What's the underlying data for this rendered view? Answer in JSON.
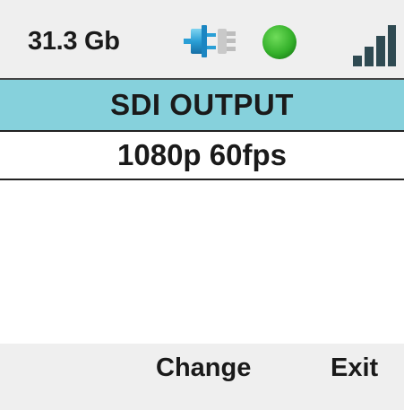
{
  "status": {
    "storage": "31.3 Gb",
    "power_icon": "power-plug-icon",
    "status_dot_icon": "status-dot-icon",
    "status_color": "#3cb043",
    "signal_icon": "signal-strength-icon",
    "signal_color": "#2f4a52"
  },
  "menu": {
    "title": "SDI OUTPUT",
    "title_bg_color": "#86d1dc",
    "value": "1080p 60fps"
  },
  "softkeys": {
    "change": "Change",
    "exit": "Exit"
  }
}
